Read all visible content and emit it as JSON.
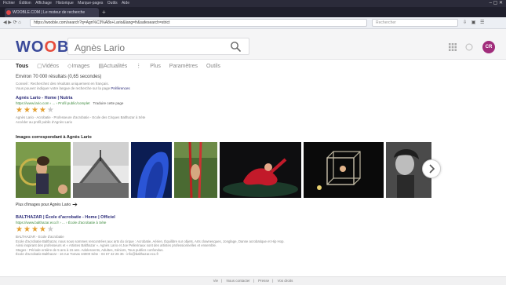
{
  "browser": {
    "menu": [
      "Fichier",
      "Édition",
      "Affichage",
      "Historique",
      "Marque-pages",
      "Outils",
      "Aide"
    ],
    "tab_title": "WOOBLE.COM | Le moteur de recherche",
    "url": "https://wooble.com/search?q=Agn%C3%A8s+Lario&lang=fr&safesearch=strict",
    "search_placeholder": "Rechercher"
  },
  "header": {
    "logo_prefix": "W",
    "logo_suffix": "BLE",
    "search_value": "Agnès Lario",
    "avatar_initials": "CR"
  },
  "tabs": [
    {
      "label": "Tous",
      "active": true
    },
    {
      "label": "Vidéos",
      "active": false
    },
    {
      "label": "Images",
      "active": false
    },
    {
      "label": "Actualités",
      "active": false
    },
    {
      "label": "Plus",
      "active": false
    },
    {
      "label": "Paramètres",
      "active": false
    },
    {
      "label": "Outils",
      "active": false
    }
  ],
  "results_info": "Environ 70 000 résultats (0,65 secondes)",
  "hint_line1": "Conseil : Recherchez des résultats uniquement en français.",
  "hint_line2": "Vous pouvez indiquer votre langue de recherche sur la page",
  "hint_link": "Préférences",
  "result1": {
    "title": "Agnès Lario - Home | Nutria",
    "url": "https://www.lario.com › ... › Profil public/complet",
    "translate": "Traduire cette page",
    "rating": 4,
    "desc1": "Agnès Lario - Acrobatie - Professeure d'acrobatie - Ecole des Cirques Balthazar à Sète",
    "desc2": "Accéder au profil public d'Agnès Lario"
  },
  "images_header": "Images correspondant à Agnès Lario",
  "more_images": "Plus d'images pour Agnès Lario",
  "result2": {
    "title": "BALTHAZAR | École d'acrobatie - Home | Officiel",
    "url": "https://www.balthazar.eco.fr › ... › École d'acrobatie à Sète",
    "rating": 4,
    "desc1": "BALTHAZAR - Ecole d'acrobatie",
    "desc2": "Ecole d'acrobatie Balthazar, nous nous sommes rencontrées aux arts du cirque : Acrobatie, Aérien, Équilibre sur objets, Arts clownesques, Jonglage, Danse acrobatique et Hip Hop.",
    "desc3": "Ainsi inspirant des professeurs et « Artistes Balthazar ». Agnès Lario et Joe Pellerinaux sont des artistes professionnelles et ensemble.",
    "desc4": "Stages : Période entière de 5 ans à 15 ans. Adolescents, Adultes, Séniors, Tous publics confondus.",
    "desc5": "École d'acrobatie Balthazar - 16 rue Tomas 34000 Sète - 04 67 42 26 36 - info@balthazar.eco.fr"
  },
  "footer": [
    "Vie",
    "Nous contacter",
    "Presse",
    "Vos droits"
  ]
}
